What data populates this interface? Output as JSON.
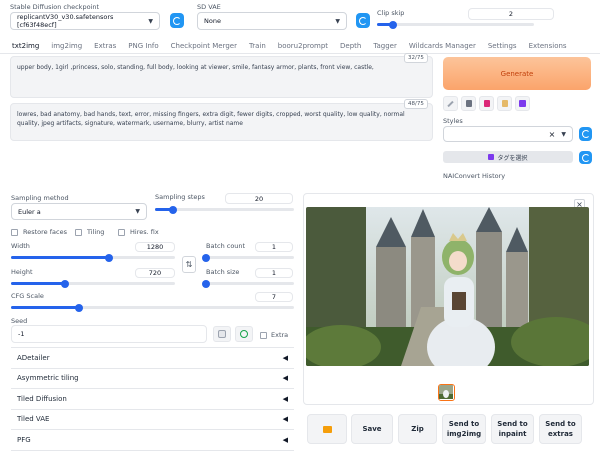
{
  "header": {
    "checkpoint_label": "Stable Diffusion checkpoint",
    "checkpoint_value": "replicantV30_v30.safetensors [cf63f48ecf]",
    "vae_label": "SD VAE",
    "vae_value": "None",
    "clip_label": "Clip skip",
    "clip_value": "2",
    "clip_level": 0.1
  },
  "tabs": [
    "txt2img",
    "img2img",
    "Extras",
    "PNG Info",
    "Checkpoint Merger",
    "Train",
    "booru2prompt",
    "Depth",
    "Tagger",
    "Wildcards Manager",
    "Settings",
    "Extensions"
  ],
  "prompt": {
    "text": "upper body, 1girl ,princess, solo, standing, full body,  looking at viewer, smile, fantasy armor, plants, front view, castle,",
    "counter": "32/75"
  },
  "negative": {
    "text": "lowres, bad anatomy, bad hands, text, error, missing fingers, extra digit, fewer digits, cropped, worst quality, low quality, normal quality, jpeg artifacts, signature, watermark, username, blurry, artist name",
    "counter": "48/75"
  },
  "generate_label": "Generate",
  "styles": {
    "label": "Styles",
    "clear_glyph": "×",
    "tag_button": "タグを選択",
    "nai_history": "NAIConvert History"
  },
  "sampling": {
    "method_label": "Sampling method",
    "method_value": "Euler a",
    "steps_label": "Sampling steps",
    "steps_value": "20",
    "steps_level": 0.13
  },
  "checkboxes": {
    "restore_faces": "Restore faces",
    "tiling": "Tiling",
    "hires_fix": "Hires. fix"
  },
  "dims": {
    "width_label": "Width",
    "width_value": "1280",
    "width_level": 0.6,
    "height_label": "Height",
    "height_value": "720",
    "height_level": 0.33,
    "swap_glyph": "⇅"
  },
  "batch": {
    "count_label": "Batch count",
    "count_value": "1",
    "count_level": 0.0,
    "size_label": "Batch size",
    "size_value": "1",
    "size_level": 0.0
  },
  "cfg": {
    "label": "CFG Scale",
    "value": "7",
    "level": 0.24
  },
  "seed": {
    "label": "Seed",
    "value": "-1",
    "extra_label": "Extra"
  },
  "accordions": [
    "ADetailer",
    "Asymmetric tiling",
    "Tiled Diffusion",
    "Tiled VAE",
    "PFG"
  ],
  "output": {
    "close_glyph": "×",
    "buttons": [
      "Save",
      "Zip",
      "Send to img2img",
      "Send to inpaint",
      "Send to extras"
    ]
  },
  "colors": {
    "accent": "#2196f3",
    "generate_bg": "#fbb583",
    "generate_text": "#c2410c",
    "slider": "#2563eb"
  }
}
